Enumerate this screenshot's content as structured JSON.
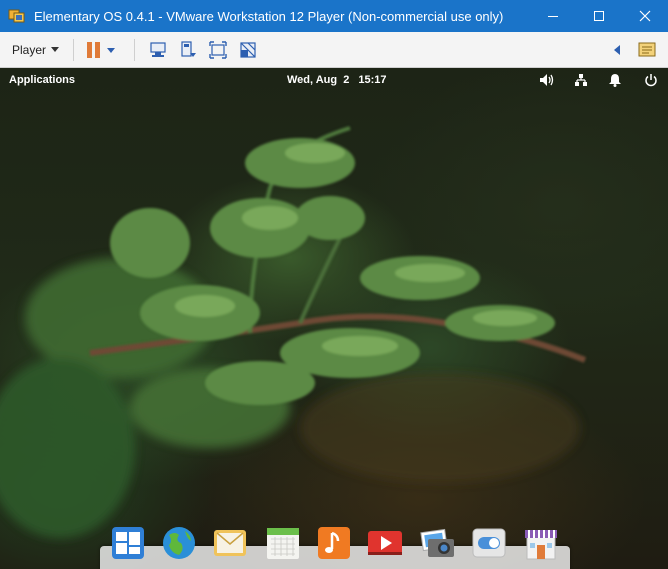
{
  "window": {
    "title": "Elementary OS 0.4.1 - VMware Workstation 12 Player (Non-commercial use only)",
    "controls": [
      "minimize-icon",
      "maximize-icon",
      "close-icon"
    ]
  },
  "toolbar": {
    "player_label": "Player",
    "buttons": [
      "pause-icon",
      "send-ctrl-alt-del-icon",
      "removable-devices-icon",
      "full-screen-icon",
      "unity-icon"
    ],
    "right_buttons": [
      "collapse-arrow-icon",
      "message-log-icon"
    ]
  },
  "guest": {
    "panel": {
      "applications_label": "Applications",
      "date": "Wed, Aug  2",
      "time": "15:17",
      "indicators": [
        "sound-icon",
        "network-icon",
        "notifications-icon",
        "power-icon"
      ]
    },
    "dock": {
      "apps": [
        "multitasking-view",
        "web-browser",
        "mail",
        "calendar",
        "music",
        "videos",
        "photos",
        "system-settings",
        "appcenter"
      ]
    }
  },
  "colors": {
    "titlebar": "#1a74c9",
    "toolbar": "#f4f4f4",
    "pause_accent": "#e07b39",
    "toolbar_icon": "#2d5fb0"
  }
}
